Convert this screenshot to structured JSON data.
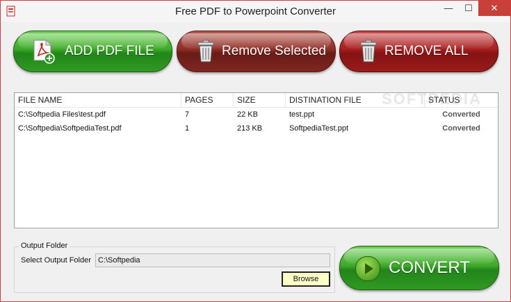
{
  "window": {
    "title": "Free PDF to Powerpoint Converter",
    "minimize_glyph": "—",
    "maximize_glyph": "☐",
    "close_glyph": "✕"
  },
  "toolbar": {
    "add_pdf_label": "ADD PDF FILE",
    "remove_selected_label": "Remove Selected",
    "remove_all_label": "REMOVE ALL"
  },
  "file_list": {
    "columns": [
      "FILE NAME",
      "PAGES",
      "SIZE",
      "DISTINATION FILE",
      "STATUS"
    ],
    "rows": [
      {
        "file_name": "C:\\Softpedia Files\\test.pdf",
        "pages": "7",
        "size": "22 KB",
        "destination": "test.ppt",
        "status": "Converted"
      },
      {
        "file_name": "C:\\Softpedia\\SoftpediaTest.pdf",
        "pages": "1",
        "size": "213 KB",
        "destination": "SoftpediaTest.ppt",
        "status": "Converted"
      }
    ]
  },
  "output": {
    "group_label": "Output Folder",
    "select_label": "Select Output Folder",
    "folder_value": "C:\\Softpedia",
    "browse_label": "Browse"
  },
  "convert": {
    "label": "CONVERT"
  },
  "watermark": "SOFTPEDIA",
  "colors": {
    "green_button": "#3da929",
    "dark_red_button": "#8e2e26",
    "red_button": "#a81f1f",
    "browse_bg": "#ffffc8"
  }
}
